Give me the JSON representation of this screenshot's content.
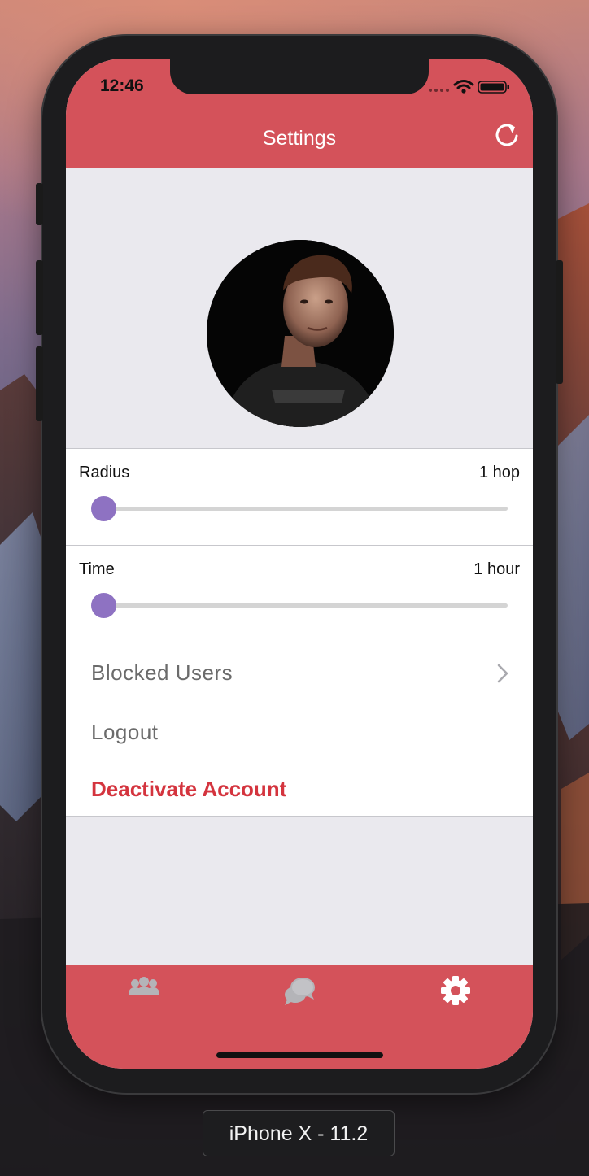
{
  "status_bar": {
    "time": "12:46"
  },
  "nav": {
    "title": "Settings",
    "refresh_icon": "refresh-icon"
  },
  "settings": {
    "radius": {
      "label": "Radius",
      "value": "1 hop",
      "level": 0
    },
    "time": {
      "label": "Time",
      "value": "1 hour",
      "level": 0
    },
    "menu": [
      {
        "label": "Blocked Users",
        "has_chevron": true
      },
      {
        "label": "Logout",
        "has_chevron": false
      },
      {
        "label": "Deactivate Account",
        "has_chevron": false,
        "destructive": true
      }
    ]
  },
  "tabbar": {
    "tabs": [
      {
        "icon": "people-icon",
        "selected": false
      },
      {
        "icon": "chat-bubbles-icon",
        "selected": false
      },
      {
        "icon": "gear-icon",
        "selected": true
      }
    ]
  },
  "device_label": "iPhone X - 11.2",
  "colors": {
    "brand": "#d4525a",
    "slider_thumb": "#8e72c2",
    "destructive_text": "#d4343e",
    "tab_inactive": "#b4b4b8",
    "tab_active": "#ffffff"
  }
}
